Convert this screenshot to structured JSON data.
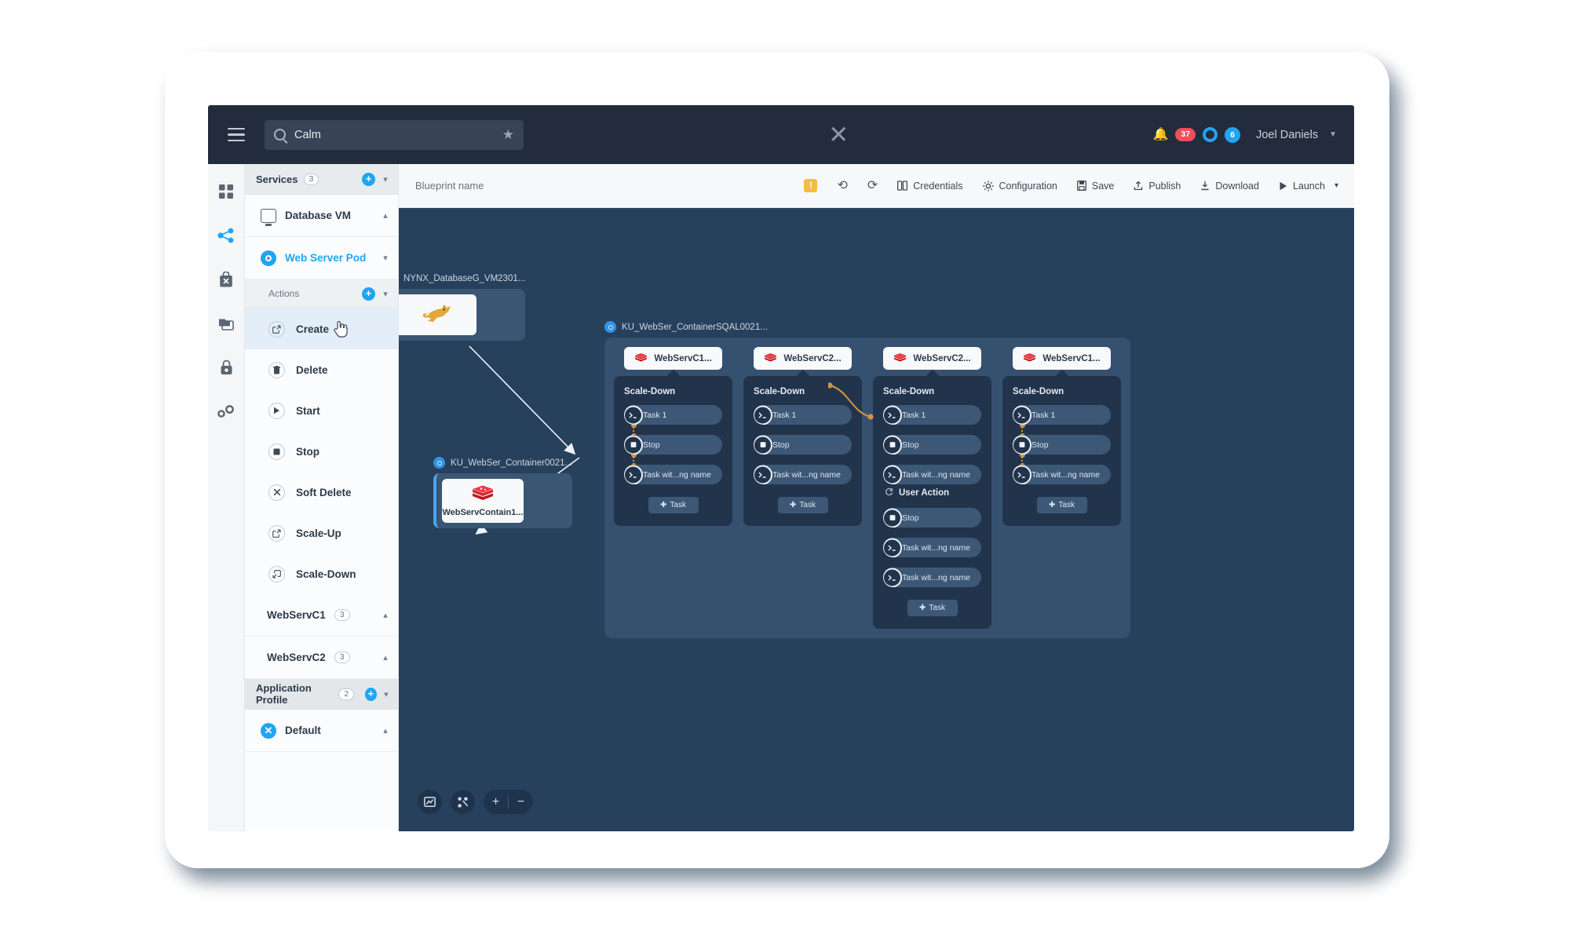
{
  "topbar": {
    "menu_icon": "hamburger-icon",
    "search": {
      "value": "Calm",
      "placeholder": "Search",
      "search_icon": "search-icon",
      "star_icon": "star-icon"
    },
    "logo": "nutanix-x-logo",
    "notifications": {
      "bell_icon": "bell-icon",
      "count": "37"
    },
    "tasks": {
      "ring_icon": "activity-ring-icon",
      "count": "6"
    },
    "user": {
      "name": "Joel Daniels",
      "caret": "chevron-down-icon"
    }
  },
  "icon_rail": [
    {
      "name": "dashboard-icon",
      "active": false
    },
    {
      "name": "blueprints-share-icon",
      "active": true
    },
    {
      "name": "marketplace-bag-icon",
      "active": false
    },
    {
      "name": "library-copies-icon",
      "active": false
    },
    {
      "name": "security-lock-icon",
      "active": false
    },
    {
      "name": "settings-gears-icon",
      "active": false
    }
  ],
  "blueprint_toolbar": {
    "blueprint_name": "Blueprint name",
    "warning_icon": "warning-badge-icon",
    "undo_icon": "undo-icon",
    "redo_icon": "redo-icon",
    "items": [
      {
        "label": "Credentials",
        "icon": "credentials-icon"
      },
      {
        "label": "Configuration",
        "icon": "gear-icon"
      },
      {
        "label": "Save",
        "icon": "save-disk-icon"
      },
      {
        "label": "Publish",
        "icon": "publish-upload-icon"
      },
      {
        "label": "Download",
        "icon": "download-icon"
      },
      {
        "label": "Launch",
        "icon": "play-icon",
        "caret": "chevron-down-icon"
      }
    ]
  },
  "left_panel": {
    "services": {
      "title": "Services",
      "count": "3",
      "add_icon": "plus-circle-icon",
      "chevron": "chevron-down-icon"
    },
    "service_rows": [
      {
        "label": "Database VM",
        "icon": "vm-monitor-icon",
        "active": false,
        "chevron": "chevron-up-icon"
      },
      {
        "label": "Web Server Pod",
        "icon": "pod-circle-icon",
        "active": true,
        "chevron": "chevron-down-icon"
      }
    ],
    "actions_header": {
      "label": "Actions",
      "add_icon": "plus-circle-icon",
      "chevron": "chevron-down-icon"
    },
    "actions": [
      {
        "label": "Create",
        "icon": "create-icon",
        "selected": true
      },
      {
        "label": "Delete",
        "icon": "trash-icon",
        "selected": false
      },
      {
        "label": "Start",
        "icon": "play-icon",
        "selected": false
      },
      {
        "label": "Stop",
        "icon": "stop-square-icon",
        "selected": false
      },
      {
        "label": "Soft Delete",
        "icon": "close-x-icon",
        "selected": false
      },
      {
        "label": "Scale-Up",
        "icon": "scale-up-icon",
        "selected": false
      },
      {
        "label": "Scale-Down",
        "icon": "scale-down-icon",
        "selected": false
      }
    ],
    "groups": [
      {
        "label": "WebServC1",
        "count": "3",
        "chevron": "chevron-up-icon"
      },
      {
        "label": "WebServC2",
        "count": "3",
        "chevron": "chevron-up-icon"
      }
    ],
    "application_profile": {
      "title": "Application Profile",
      "count": "2",
      "add_icon": "plus-circle-icon",
      "chevron": "chevron-down-icon"
    },
    "profile_rows": [
      {
        "label": "Default",
        "icon": "profile-x-icon",
        "chevron": "chevron-up-icon"
      }
    ]
  },
  "canvas": {
    "nodes": [
      {
        "label": "NYNX_DatabaseG_VM2301...",
        "badge_icon": "service-badge-icon",
        "card_icon": "tomcat-icon",
        "card_caption": ""
      },
      {
        "label": "KU_WebSer_Container0021...",
        "badge_icon": "service-badge-icon",
        "card_icon": "redis-stack-icon",
        "card_caption": "WebServContain1..."
      }
    ],
    "group": {
      "label": "KU_WebSer_ContainerSQAL0021...",
      "badge_icon": "service-badge-icon",
      "columns": [
        {
          "header": "WebServC1...",
          "header_icon": "redis-stack-icon",
          "title": "Scale-Down",
          "tasks": [
            {
              "label": "Task 1",
              "icon": "shell-task-icon"
            },
            {
              "label": "Stop",
              "icon": "stop-task-icon"
            },
            {
              "label": "Task wit...ng name",
              "icon": "shell-task-icon"
            }
          ],
          "add_task": "Task",
          "add_task_icon": "plus-icon"
        },
        {
          "header": "WebServC2...",
          "header_icon": "redis-stack-icon",
          "title": "Scale-Down",
          "tasks": [
            {
              "label": "Task 1",
              "icon": "shell-task-icon"
            },
            {
              "label": "Stop",
              "icon": "stop-task-icon"
            },
            {
              "label": "Task wit...ng name",
              "icon": "shell-task-icon"
            }
          ],
          "add_task": "Task",
          "add_task_icon": "plus-icon"
        },
        {
          "header": "WebServC2...",
          "header_icon": "redis-stack-icon",
          "title": "Scale-Down",
          "tasks": [
            {
              "label": "Task 1",
              "icon": "shell-task-icon"
            },
            {
              "label": "Stop",
              "icon": "stop-task-icon"
            },
            {
              "label": "Task wit...ng name",
              "icon": "shell-task-icon"
            }
          ],
          "divider": {
            "label": "User Action",
            "icon": "user-action-icon"
          },
          "tasks2": [
            {
              "label": "Stop",
              "icon": "stop-task-icon"
            },
            {
              "label": "Task wit...ng name",
              "icon": "shell-task-icon"
            },
            {
              "label": "Task wit...ng name",
              "icon": "shell-task-icon"
            }
          ],
          "add_task": "Task",
          "add_task_icon": "plus-icon"
        },
        {
          "header": "WebServC1...",
          "header_icon": "redis-stack-icon",
          "title": "Scale-Down",
          "tasks": [
            {
              "label": "Task 1",
              "icon": "shell-task-icon"
            },
            {
              "label": "Stop",
              "icon": "stop-task-icon"
            },
            {
              "label": "Task wit...ng name",
              "icon": "shell-task-icon"
            }
          ],
          "add_task": "Task",
          "add_task_icon": "plus-icon"
        }
      ]
    },
    "controls": [
      {
        "name": "fit-to-screen-button",
        "icon": "fit-screen-icon"
      },
      {
        "name": "auto-layout-button",
        "icon": "auto-layout-icon"
      },
      {
        "name": "zoom-in-button",
        "icon": "plus-icon",
        "label": "+"
      },
      {
        "name": "zoom-out-button",
        "icon": "minus-icon",
        "label": "−"
      }
    ]
  },
  "colors": {
    "topbar_bg": "#222c3c",
    "canvas_bg": "#27405c",
    "group_bg": "#365070",
    "column_bg": "#22344b",
    "accent_blue": "#1fa5f3",
    "alert_red": "#ef4e5b",
    "connector_orange": "#d8933c",
    "warning_yellow": "#f5bc42"
  }
}
